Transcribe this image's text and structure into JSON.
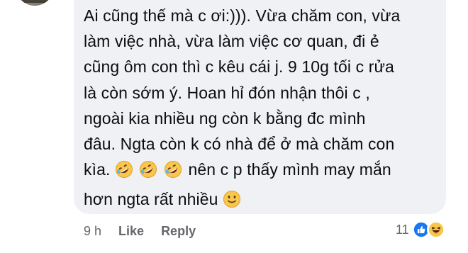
{
  "comment": {
    "lines": [
      "Ai cũng thế mà c ơi:))). Vừa chăm con, vừa",
      "làm việc nhà, vừa làm việc cơ quan, đi ẻ",
      "cũng ôm con thì c kêu cái j. 9 10g tối c rửa",
      "là còn sớm ý. Hoan hỉ đón nhận thôi c ,",
      "ngoài kia nhiều ng còn k bằng đc mình",
      "đâu. Ngta còn k có nhà để ở mà chăm con"
    ],
    "line7_start": "kìa.",
    "line7_end": "nên c p thấy mình may mắn",
    "line8": "hơn ngta rất nhiều",
    "icons": {
      "laugh": "rolling-on-floor-laughing-icon",
      "smile": "slightly-smiling-icon"
    },
    "colors": {
      "bubble": "#eff1f4",
      "text": "#0b0c0e",
      "meta": "#65676b",
      "like_blue": "#1877f2",
      "haha_yellow": "#f7c64a"
    }
  },
  "meta": {
    "time": "9 h",
    "like": "Like",
    "reply": "Reply"
  },
  "reactions": {
    "count": "11",
    "icons": [
      "like-reaction-icon",
      "haha-reaction-icon"
    ]
  }
}
